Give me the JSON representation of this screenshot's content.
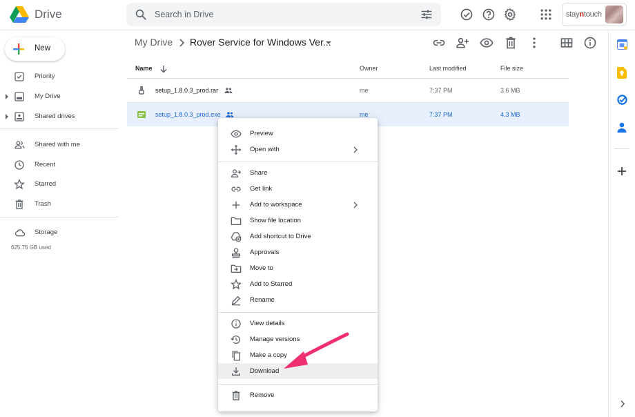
{
  "app": {
    "name": "Drive"
  },
  "search": {
    "placeholder": "Search in Drive"
  },
  "header_icons": [
    "check-circle-icon",
    "help-icon",
    "settings-icon",
    "apps-grid-icon"
  ],
  "brand": {
    "part1": "stay",
    "part2": "n",
    "part3": "touch"
  },
  "sidebar": {
    "new_label": "New",
    "items": [
      {
        "label": "Priority",
        "icon": "priority-icon"
      },
      {
        "label": "My Drive",
        "icon": "my-drive-icon"
      },
      {
        "label": "Shared drives",
        "icon": "shared-drives-icon"
      },
      {
        "label": "Shared with me",
        "icon": "shared-with-me-icon"
      },
      {
        "label": "Recent",
        "icon": "clock-icon"
      },
      {
        "label": "Starred",
        "icon": "star-icon"
      },
      {
        "label": "Trash",
        "icon": "trash-icon"
      },
      {
        "label": "Storage",
        "icon": "cloud-icon"
      }
    ],
    "storage_used": "625.76 GB used"
  },
  "breadcrumb": {
    "root": "My Drive",
    "current": "Rover Service for Windows Ver..."
  },
  "table": {
    "columns": {
      "name": "Name",
      "owner": "Owner",
      "modified": "Last modified",
      "size": "File size"
    },
    "rows": [
      {
        "name": "setup_1.8.0.3_prod.rar",
        "owner": "me",
        "modified": "7:37 PM",
        "size": "3.6 MB",
        "selected": false
      },
      {
        "name": "setup_1.8.0.3_prod.exe",
        "owner": "me",
        "modified": "7:37 PM",
        "size": "4.3 MB",
        "selected": true
      }
    ]
  },
  "context_menu": {
    "items": [
      {
        "label": "Preview",
        "icon": "eye-icon"
      },
      {
        "label": "Open with",
        "icon": "open-with-icon",
        "submenu": true
      },
      {
        "label": "Share",
        "icon": "person-add-icon"
      },
      {
        "label": "Get link",
        "icon": "link-icon"
      },
      {
        "label": "Add to workspace",
        "icon": "plus-icon",
        "submenu": true
      },
      {
        "label": "Show file location",
        "icon": "folder-icon"
      },
      {
        "label": "Add shortcut to Drive",
        "icon": "drive-shortcut-icon"
      },
      {
        "label": "Approvals",
        "icon": "approvals-icon"
      },
      {
        "label": "Move to",
        "icon": "move-to-icon"
      },
      {
        "label": "Add to Starred",
        "icon": "star-outline-icon"
      },
      {
        "label": "Rename",
        "icon": "pencil-icon"
      },
      {
        "label": "View details",
        "icon": "info-icon"
      },
      {
        "label": "Manage versions",
        "icon": "history-icon"
      },
      {
        "label": "Make a copy",
        "icon": "copy-icon"
      },
      {
        "label": "Download",
        "icon": "download-icon",
        "highlighted": true
      },
      {
        "label": "Remove",
        "icon": "trash-icon"
      }
    ]
  },
  "colors": {
    "accent": "#1a73e8",
    "selected_row": "#e8f0fe",
    "annotation_arrow": "#f0306e"
  }
}
